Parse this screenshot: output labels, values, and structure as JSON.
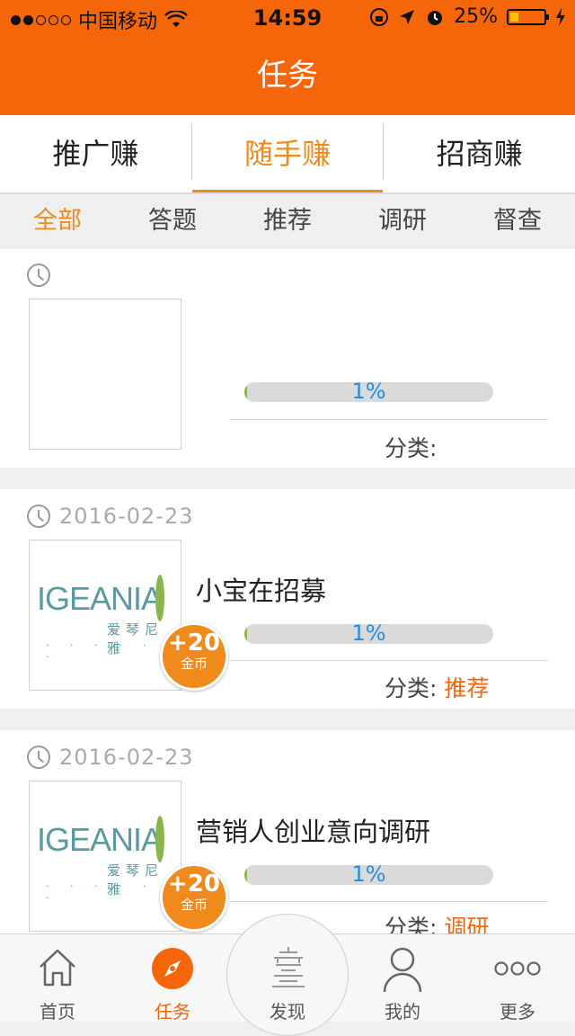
{
  "status_bar": {
    "carrier": "中国移动",
    "time": "14:59",
    "battery": "25%",
    "battery_fraction": 0.25
  },
  "header": {
    "title": "任务"
  },
  "top_tabs": [
    {
      "label": "推广赚"
    },
    {
      "label": "随手赚",
      "active": true
    },
    {
      "label": "招商赚"
    }
  ],
  "sub_tabs": [
    {
      "label": "全部",
      "active": true
    },
    {
      "label": "答题"
    },
    {
      "label": "推荐"
    },
    {
      "label": "调研"
    },
    {
      "label": "督查"
    }
  ],
  "tasks": [
    {
      "date": "",
      "title": "",
      "progress_label": "1%",
      "progress_fraction": 0.01,
      "category_label": "分类:",
      "category": "",
      "coin_amount": "",
      "coin_unit": ""
    },
    {
      "date": "2016-02-23",
      "title": "小宝在招募",
      "progress_label": "1%",
      "progress_fraction": 0.01,
      "category_label": "分类:",
      "category": "推荐",
      "coin_amount": "+20",
      "coin_unit": "金币",
      "thumb_logo": "IGEANIA",
      "thumb_logo_cn": "爱琴尼雅"
    },
    {
      "date": "2016-02-23",
      "title": "营销人创业意向调研",
      "progress_label": "1%",
      "progress_fraction": 0.01,
      "category_label": "分类:",
      "category": "调研",
      "coin_amount": "+20",
      "coin_unit": "金币",
      "thumb_logo": "IGEANIA",
      "thumb_logo_cn": "爱琴尼雅"
    }
  ],
  "tab_bar": [
    {
      "label": "首页",
      "icon": "home-icon"
    },
    {
      "label": "任务",
      "icon": "compass-icon",
      "active": true
    },
    {
      "label": "发现",
      "icon": "discover-icon"
    },
    {
      "label": "我的",
      "icon": "user-icon"
    },
    {
      "label": "更多",
      "icon": "more-icon"
    }
  ],
  "colors": {
    "accent": "#f5660a",
    "tab_active": "#f08a1c",
    "progress_text": "#1e8fe6",
    "progress_fill": "#8ab54a"
  }
}
